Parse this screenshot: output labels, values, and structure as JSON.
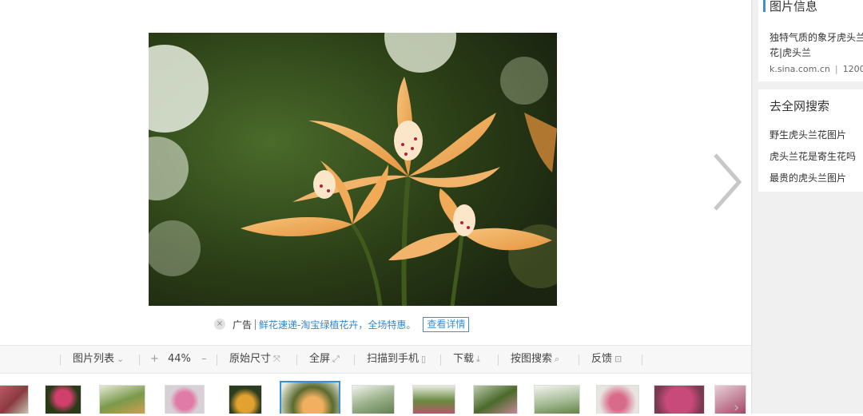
{
  "ad": {
    "close_icon": "×",
    "label": "广告",
    "text": "鲜花速递-淘宝绿植花卉，全场特惠。",
    "button": "查看详情"
  },
  "toolbar": {
    "image_list": "图片列表",
    "image_list_icon": "⌄",
    "zoom_in": "+",
    "zoom_level": "44%",
    "zoom_out": "–",
    "original_size": "原始尺寸",
    "original_size_icon": "⤧",
    "fullscreen": "全屏",
    "fullscreen_icon": "⤢",
    "scan_to_phone": "扫描到手机",
    "scan_icon": "▯",
    "download": "下载",
    "download_icon": "⤓",
    "search_by_image": "按图搜索",
    "search_icon": "⌕",
    "feedback": "反馈",
    "feedback_icon": "⊡"
  },
  "sidebar": {
    "info_title": "图片信息",
    "info_desc": "独特气质的象牙虎头兰花|虎头兰",
    "source": "k.sina.com.cn",
    "size": "1200",
    "search_title": "去全网搜索",
    "search_links": [
      "野生虎头兰花图片",
      "虎头兰花是寄生花吗",
      "最贵的虎头兰图片"
    ]
  },
  "strip": {
    "arrow": "›"
  },
  "colors": {
    "accent": "#3b8fd9",
    "link": "#3388cc"
  }
}
